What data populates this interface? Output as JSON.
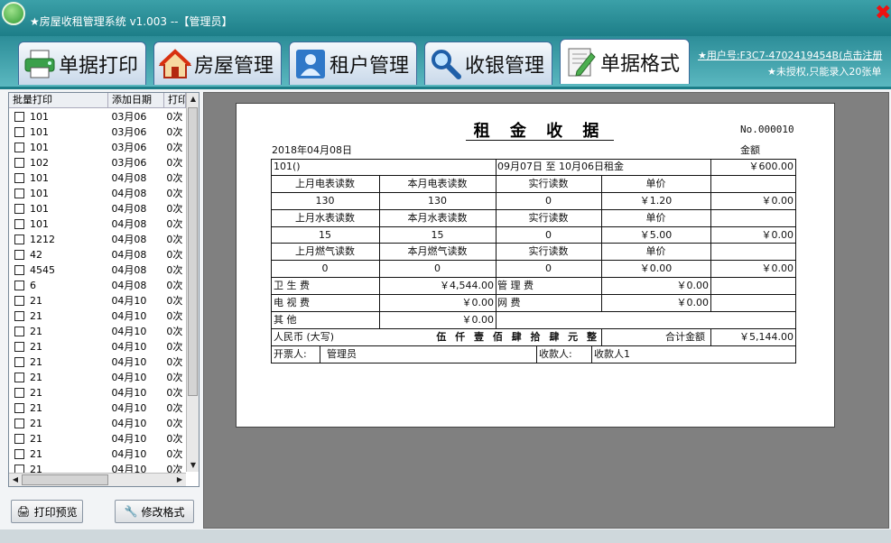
{
  "app": {
    "title": "★房屋收租管理系统 v1.003  --【管理员】"
  },
  "tabs": [
    {
      "label": "单据打印",
      "icon": "printer-icon"
    },
    {
      "label": "房屋管理",
      "icon": "house-icon"
    },
    {
      "label": "租户管理",
      "icon": "person-icon"
    },
    {
      "label": "收银管理",
      "icon": "magnifier-icon"
    },
    {
      "label": "单据格式",
      "icon": "edit-document-icon"
    }
  ],
  "license": {
    "link": "★用户号:F3C7-4702419454B(点击注册",
    "note": "★未授权,只能录入20张单"
  },
  "list": {
    "headers": [
      "批量打印",
      "添加日期",
      "打印"
    ],
    "rows": [
      {
        "name": "101",
        "date": "03月06",
        "printed": "0次"
      },
      {
        "name": "101",
        "date": "03月06",
        "printed": "0次"
      },
      {
        "name": "101",
        "date": "03月06",
        "printed": "0次"
      },
      {
        "name": "102",
        "date": "03月06",
        "printed": "0次"
      },
      {
        "name": "101",
        "date": "04月08",
        "printed": "0次"
      },
      {
        "name": "101",
        "date": "04月08",
        "printed": "0次"
      },
      {
        "name": "101",
        "date": "04月08",
        "printed": "0次"
      },
      {
        "name": "101",
        "date": "04月08",
        "printed": "0次"
      },
      {
        "name": "1212",
        "date": "04月08",
        "printed": "0次"
      },
      {
        "name": "42",
        "date": "04月08",
        "printed": "0次"
      },
      {
        "name": "4545",
        "date": "04月08",
        "printed": "0次"
      },
      {
        "name": "6",
        "date": "04月08",
        "printed": "0次"
      },
      {
        "name": "21",
        "date": "04月10",
        "printed": "0次"
      },
      {
        "name": "21",
        "date": "04月10",
        "printed": "0次"
      },
      {
        "name": "21",
        "date": "04月10",
        "printed": "0次"
      },
      {
        "name": "21",
        "date": "04月10",
        "printed": "0次"
      },
      {
        "name": "21",
        "date": "04月10",
        "printed": "0次"
      },
      {
        "name": "21",
        "date": "04月10",
        "printed": "0次"
      },
      {
        "name": "21",
        "date": "04月10",
        "printed": "0次"
      },
      {
        "name": "21",
        "date": "04月10",
        "printed": "0次"
      },
      {
        "name": "21",
        "date": "04月10",
        "printed": "0次"
      },
      {
        "name": "21",
        "date": "04月10",
        "printed": "0次"
      },
      {
        "name": "21",
        "date": "04月10",
        "printed": "0次"
      },
      {
        "name": "21",
        "date": "04月10",
        "printed": "0次"
      }
    ]
  },
  "buttons": {
    "preview": "打印预览",
    "edit_format": "修改格式"
  },
  "receipt": {
    "title": "租 金 收 据",
    "no": "No.000010",
    "date": "2018年04月08日",
    "amount_header": "金额",
    "room": "101()",
    "period": "09月07日 至 10月06日租金",
    "rent": "￥600.00",
    "elec_prev_label": "上月电表读数",
    "elec_cur_label": "本月电表读数",
    "actual_label": "实行读数",
    "unit_price_label": "单价",
    "elec_prev": "130",
    "elec_cur": "130",
    "elec_actual": "0",
    "elec_price": "￥1.20",
    "elec_amount": "￥0.00",
    "water_prev_label": "上月水表读数",
    "water_cur_label": "本月水表读数",
    "water_prev": "15",
    "water_cur": "15",
    "water_actual": "0",
    "water_price": "￥5.00",
    "water_amount": "￥0.00",
    "gas_prev_label": "上月燃气读数",
    "gas_cur_label": "本月燃气读数",
    "gas_prev": "0",
    "gas_cur": "0",
    "gas_actual": "0",
    "gas_price": "￥0.00",
    "gas_amount": "￥0.00",
    "hygiene_label": "卫 生 费",
    "hygiene": "￥4,544.00",
    "mgmt_label": "管 理 费",
    "mgmt": "￥0.00",
    "tv_label": "电 视 费",
    "tv": "￥0.00",
    "net_label": "网      费",
    "net": "￥0.00",
    "other_label": "其      他",
    "other": "￥0.00",
    "rmb_label": "人民币 (大写)",
    "rmb_upper": "伍 仟 壹 佰 肆 拾 肆 元 整",
    "total_label": "合计金额",
    "total": "￥5,144.00",
    "issuer_label": "开票人:",
    "issuer": "管理员",
    "payee_label": "收款人:",
    "payee": "收款人1"
  }
}
